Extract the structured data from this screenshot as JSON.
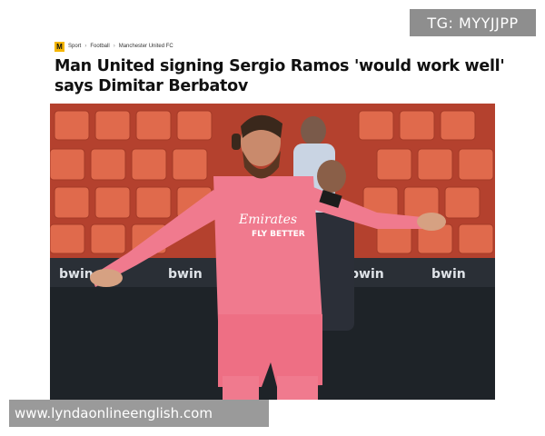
{
  "watermark": {
    "tg_label": "TG: MYYJJPP"
  },
  "breadcrumb": {
    "logo_letter": "M",
    "items": [
      "Sport",
      "Football",
      "Manchester United FC"
    ],
    "separator": "›"
  },
  "article": {
    "headline": "Man United signing Sergio Ramos 'would work well' says Dimitar Berbatov"
  },
  "photo": {
    "shirt_sponsor": "Emirates",
    "shirt_slogan": "FLY BETTER",
    "board_text": [
      "bwin",
      "bwin",
      "bwin",
      "bwin"
    ]
  },
  "footer": {
    "url": "www.lyndaonlineenglish.com"
  },
  "colors": {
    "accent_logo": "#f5b600",
    "kit_pink": "#f07a8e",
    "seats": "#d9563e"
  }
}
